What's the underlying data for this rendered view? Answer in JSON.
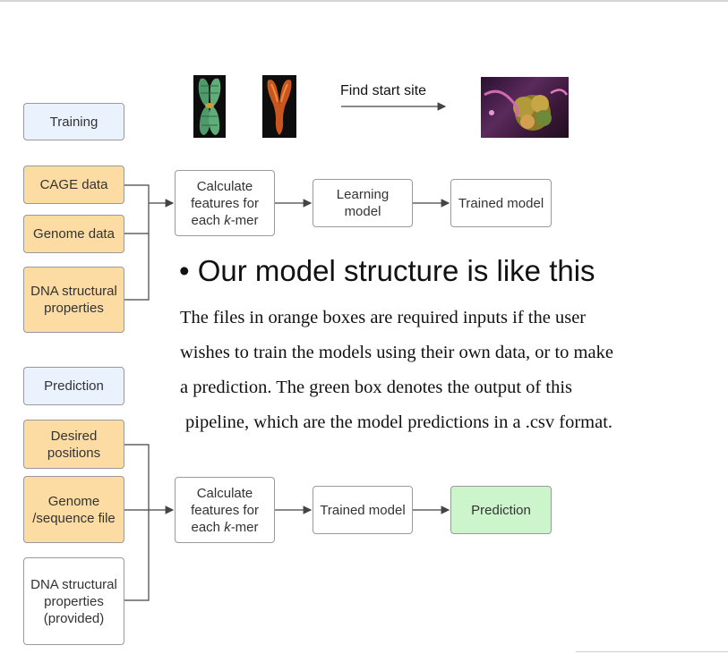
{
  "header_images": {
    "find_start_label": "Find start site"
  },
  "training": {
    "section_label": "Training",
    "inputs": [
      "CAGE data",
      "Genome data",
      "DNA structural properties"
    ],
    "step_calc": "Calculate features for each k-mer",
    "step_learn": "Learning model",
    "output": "Trained model"
  },
  "prediction": {
    "section_label": "Prediction",
    "inputs": [
      "Desired positions",
      "Genome /sequence file",
      "DNA structural properties (provided)"
    ],
    "step_calc": "Calculate features for each k-mer",
    "step_model": "Trained model",
    "output": "Prediction"
  },
  "text": {
    "bullet": "•",
    "title": "Our model structure is like this",
    "lines": [
      "The files in orange boxes are required inputs if the user",
      "wishes to train the models using their own data, or to make",
      "a prediction. The green box denotes the output of this",
      "pipeline, which are the model predictions in a .csv format."
    ]
  },
  "colors": {
    "section_box": "#eaf3fd",
    "input_box": "#fcdca3",
    "output_box": "#cdf5cc",
    "connector": "#444444"
  }
}
